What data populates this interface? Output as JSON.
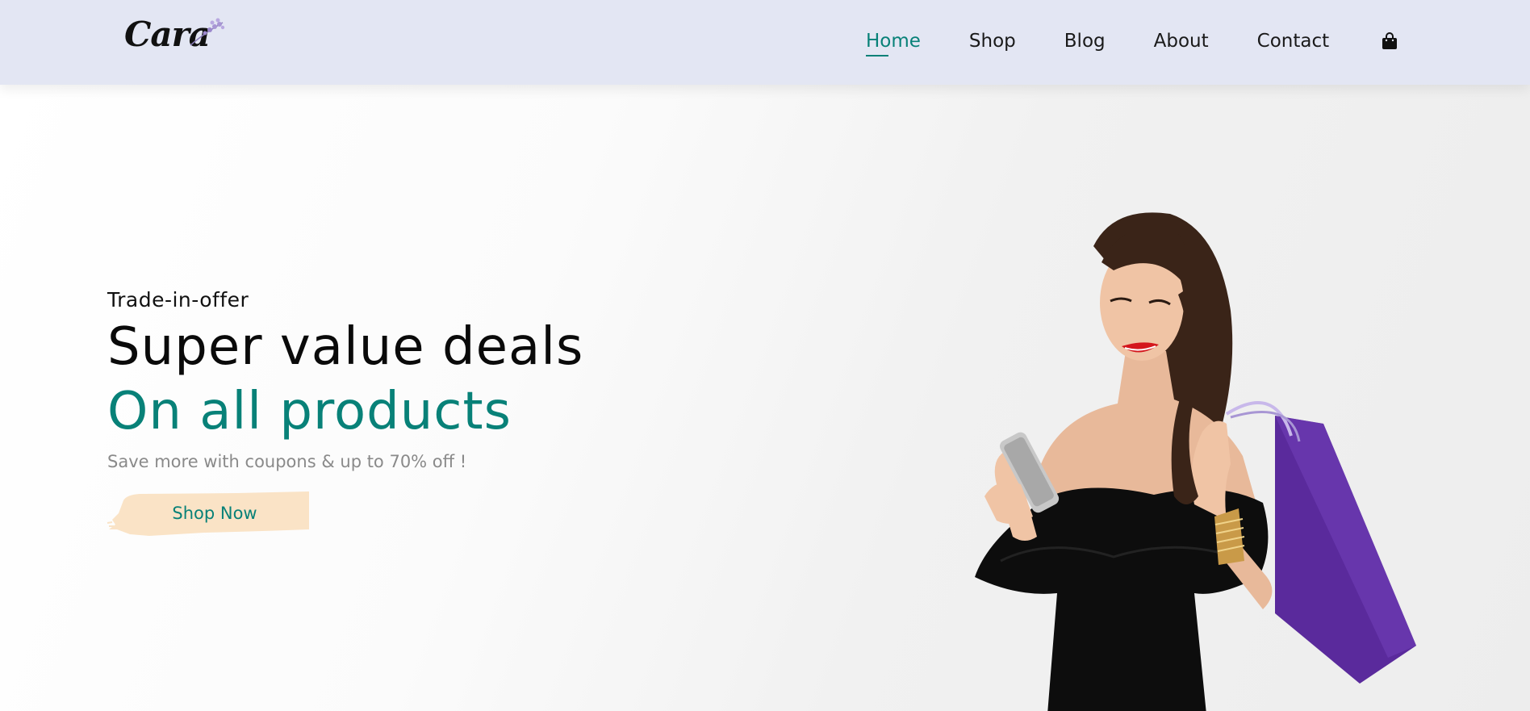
{
  "brand": {
    "logo_text": "Cara"
  },
  "nav": {
    "items": [
      {
        "label": "Home",
        "active": true
      },
      {
        "label": "Shop",
        "active": false
      },
      {
        "label": "Blog",
        "active": false
      },
      {
        "label": "About",
        "active": false
      },
      {
        "label": "Contact",
        "active": false
      }
    ],
    "cart_icon": "shopping-bag-icon"
  },
  "hero": {
    "eyebrow": "Trade-in-offer",
    "headline": "Super value deals",
    "subheadline": "On all products",
    "description": "Save more with coupons & up to 70% off !",
    "cta_label": "Shop Now",
    "image": "woman-with-phone-and-shopping-bag"
  },
  "colors": {
    "accent": "#088178",
    "header_bg": "#e3e6f3",
    "button_bg": "#fae3c6",
    "bag": "#5a2a9c"
  }
}
